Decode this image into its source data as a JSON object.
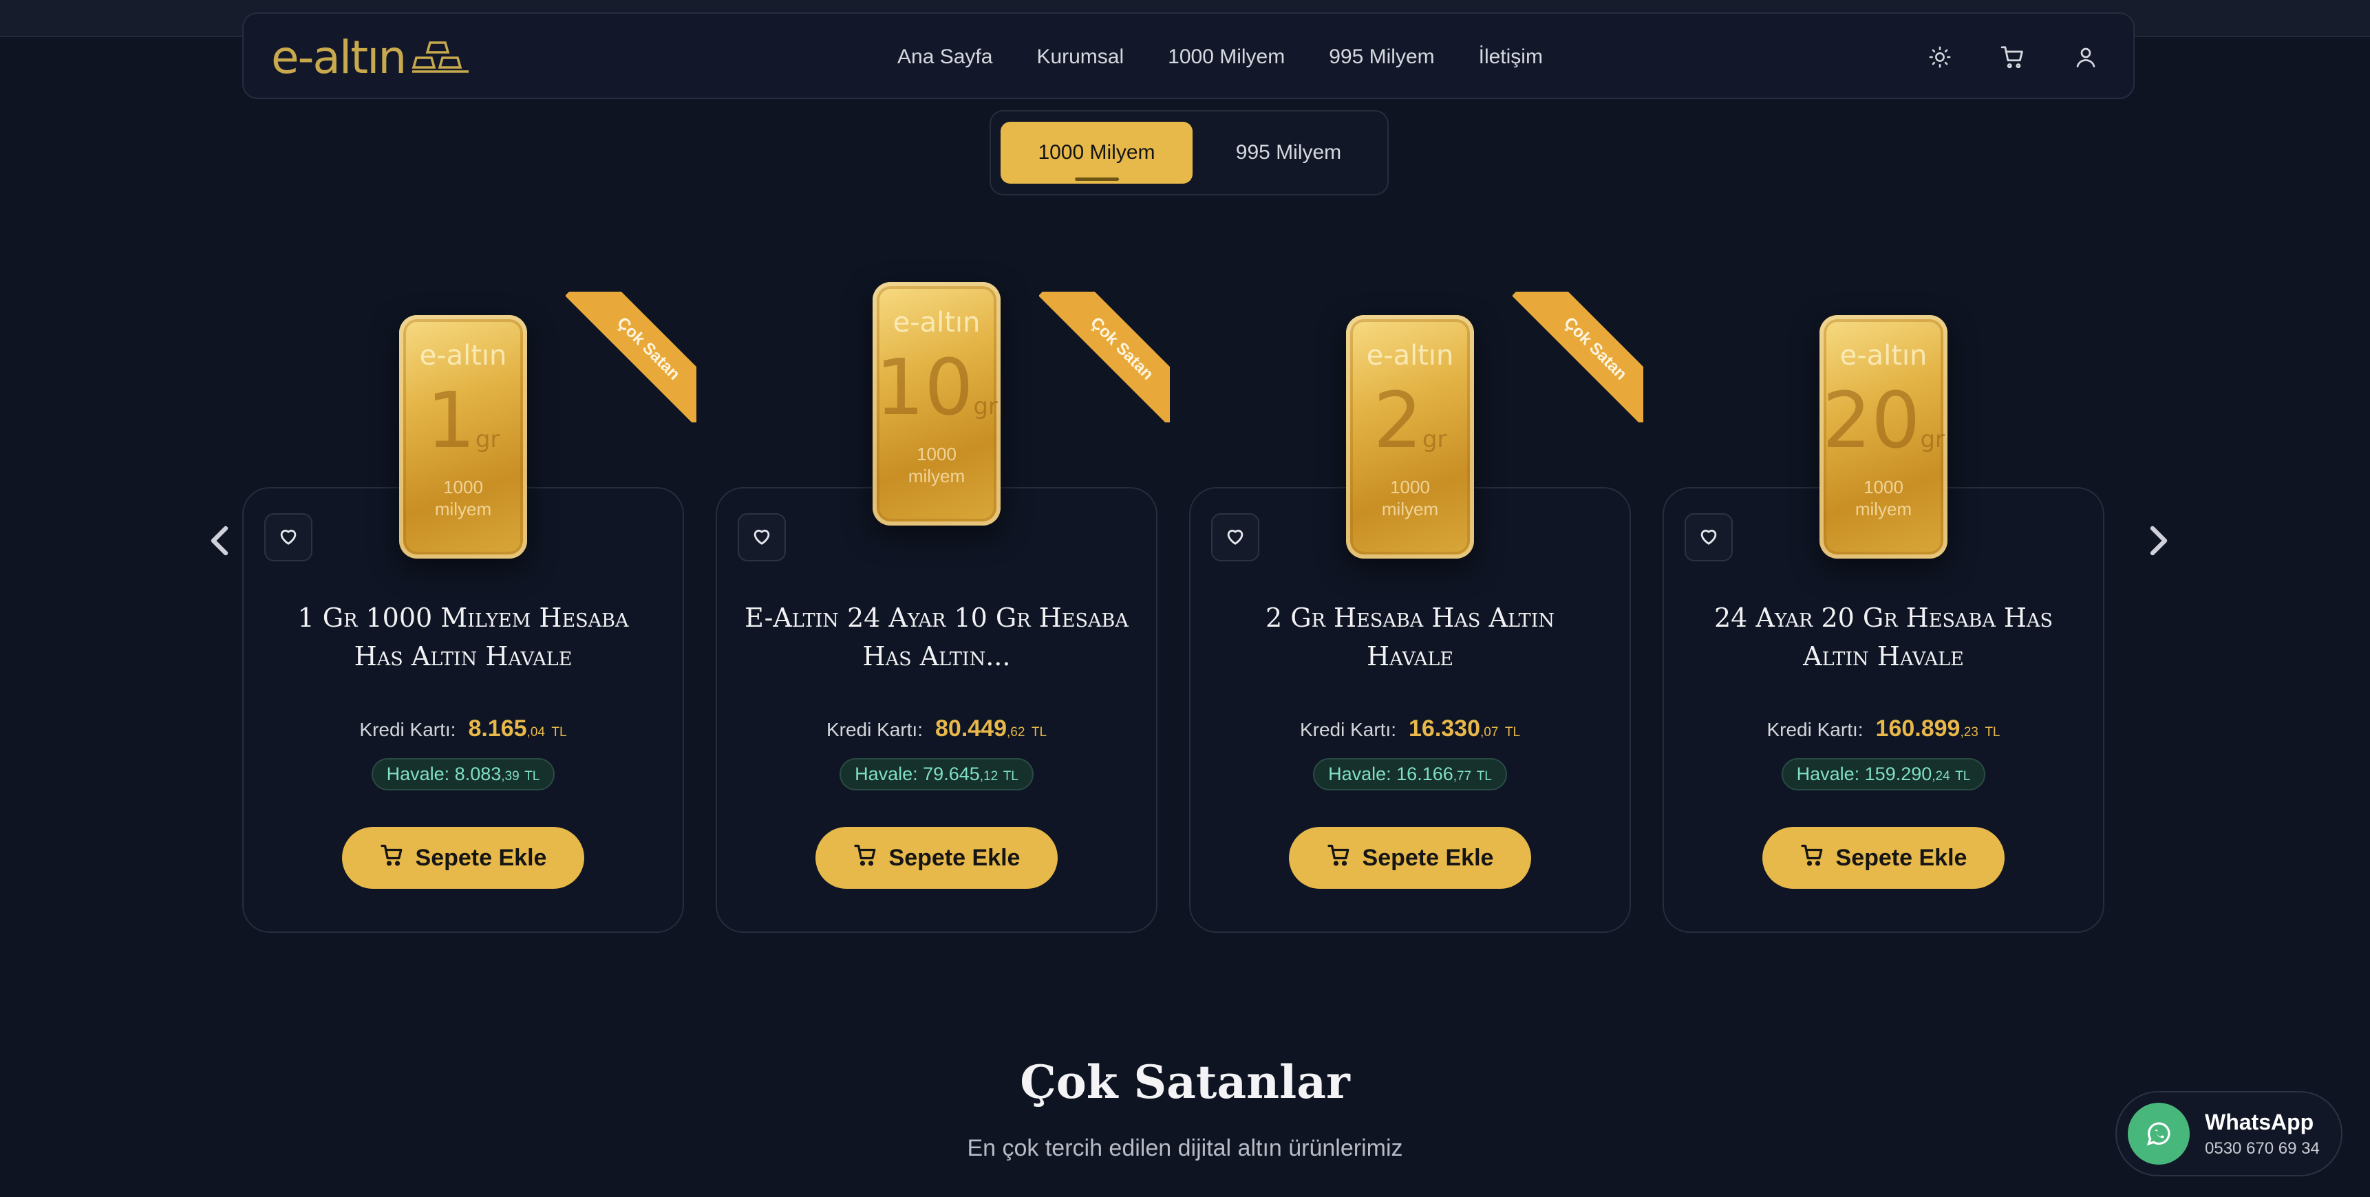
{
  "brand": {
    "logo_text": "e-altın"
  },
  "nav": {
    "links": [
      "Ana Sayfa",
      "Kurumsal",
      "1000 Milyem",
      "995 Milyem",
      "İletişim"
    ],
    "icons": [
      "sun-icon",
      "cart-icon",
      "user-icon"
    ]
  },
  "tabs": [
    "1000 Milyem",
    "995 Milyem"
  ],
  "colors": {
    "accent": "#e7b94a",
    "background": "#0e1422",
    "ribbon": "#e9a93a",
    "havale": "#7fe0c4",
    "whatsapp": "#48b77c"
  },
  "labels": {
    "kredi": "Kredi Kartı:",
    "cart_button": "Sepete Ekle",
    "ribbon": "Çok Satan",
    "currency": "TL",
    "bar_brand": "e-altın",
    "bar_unit": "gr",
    "bar_milyem": [
      "1000",
      "milyem"
    ]
  },
  "products": [
    {
      "title": "1 Gr 1000 Milyem Hesaba Has Altın Havale",
      "grams": "1",
      "kredi_main": "8.165",
      "kredi_cents": ",04",
      "havale_label": "Havale: 8.083",
      "havale_cents": ",39",
      "ribbon": true
    },
    {
      "title": "E-Altın 24 Ayar 10 Gr Hesaba Has Altın...",
      "grams": "10",
      "kredi_main": "80.449",
      "kredi_cents": ",62",
      "havale_label": "Havale: 79.645",
      "havale_cents": ",12",
      "ribbon": true
    },
    {
      "title": "2 Gr Hesaba Has Altın Havale",
      "grams": "2",
      "kredi_main": "16.330",
      "kredi_cents": ",07",
      "havale_label": "Havale: 16.166",
      "havale_cents": ",77",
      "ribbon": true
    },
    {
      "title": "24 Ayar 20 Gr Hesaba Has Altin Havale",
      "grams": "20",
      "kredi_main": "160.899",
      "kredi_cents": ",23",
      "havale_label": "Havale: 159.290",
      "havale_cents": ",24",
      "ribbon": false
    }
  ],
  "section": {
    "title": "Çok Satanlar",
    "subtitle": "En çok tercih edilen dijital altın ürünlerimiz"
  },
  "whatsapp": {
    "title": "WhatsApp",
    "phone": "0530 670 69 34"
  }
}
